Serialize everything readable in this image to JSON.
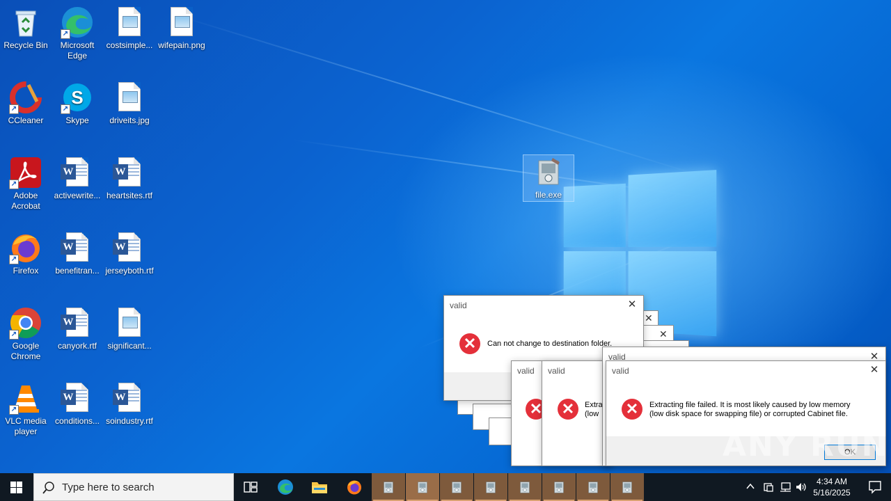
{
  "desktop": {
    "icons": [
      {
        "label": "Recycle Bin",
        "icon": "recycle-bin-icon"
      },
      {
        "label": "Microsoft Edge",
        "icon": "edge-icon"
      },
      {
        "label": "costsimple...",
        "icon": "image-file-icon"
      },
      {
        "label": "wifepain.png",
        "icon": "image-file-icon"
      },
      {
        "label": "CCleaner",
        "icon": "ccleaner-icon"
      },
      {
        "label": "Skype",
        "icon": "skype-icon"
      },
      {
        "label": "driveits.jpg",
        "icon": "image-file-icon"
      },
      {
        "label": "Adobe Acrobat",
        "icon": "acrobat-icon"
      },
      {
        "label": "activewrite...",
        "icon": "word-doc-icon"
      },
      {
        "label": "heartsites.rtf",
        "icon": "word-doc-icon"
      },
      {
        "label": "Firefox",
        "icon": "firefox-icon"
      },
      {
        "label": "benefitran...",
        "icon": "word-doc-icon"
      },
      {
        "label": "jerseyboth.rtf",
        "icon": "word-doc-icon"
      },
      {
        "label": "Google Chrome",
        "icon": "chrome-icon"
      },
      {
        "label": "canyork.rtf",
        "icon": "word-doc-icon"
      },
      {
        "label": "significant...",
        "icon": "image-file-icon"
      },
      {
        "label": "VLC media player",
        "icon": "vlc-icon"
      },
      {
        "label": "conditions...",
        "icon": "word-doc-icon"
      },
      {
        "label": "soindustry.rtf",
        "icon": "word-doc-icon"
      },
      {
        "label": "file.exe",
        "icon": "installer-icon"
      }
    ]
  },
  "dialogs": {
    "folder_error": {
      "title": "valid",
      "message": "Can not change to destination folder.",
      "close": "✕"
    },
    "extract_error": {
      "title": "valid",
      "message_line1": "Extracting file failed.  It is most likely caused by low memory",
      "message_line2": "(low disk space for swapping file) or corrupted Cabinet file.",
      "ok_label": "OK",
      "close": "✕"
    },
    "stacked_titles": [
      "valid",
      "valid",
      "valid"
    ],
    "partial_text_1": "Extra",
    "partial_text_2": "(low"
  },
  "taskbar": {
    "search_placeholder": "Type here to search",
    "time": "4:34 AM",
    "date": "5/16/2025",
    "pinned": [
      "task-view-icon",
      "edge-icon",
      "file-explorer-icon",
      "firefox-icon"
    ],
    "running_count": 8
  },
  "watermark": "ANY RUN"
}
